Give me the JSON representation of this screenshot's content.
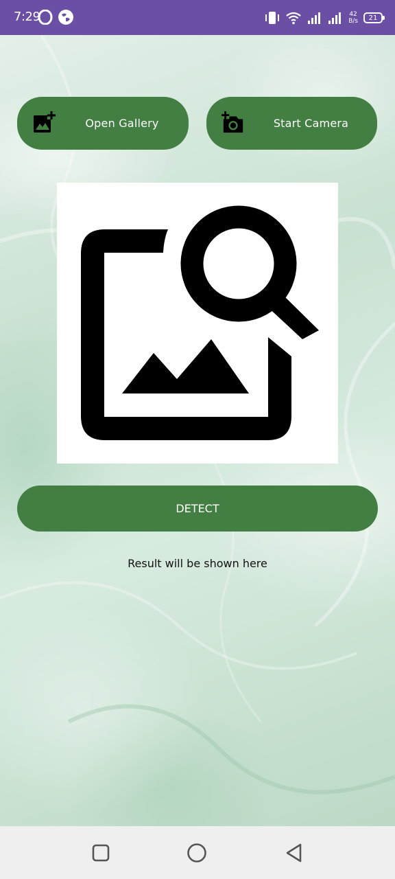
{
  "status_bar": {
    "time": "7:29",
    "net_speed_value": "42",
    "net_speed_unit": "B/s",
    "battery": "21",
    "icons": [
      "opera-icon",
      "vpn-globe-icon",
      "vibrate-icon",
      "wifi-icon",
      "signal-icon",
      "signal-icon",
      "battery-icon"
    ]
  },
  "buttons": {
    "gallery_label": "Open Gallery",
    "camera_label": "Start Camera",
    "detect_label": "DETECT"
  },
  "preview": {
    "icon": "image-search-icon"
  },
  "result": {
    "text": "Result will be shown here"
  },
  "nav_bar": {
    "icons": [
      "recents-icon",
      "home-icon",
      "back-icon"
    ]
  },
  "colors": {
    "status_bar": "#6a4fa5",
    "button": "#437f42",
    "button_text": "#ffffff",
    "nav_bar": "#efefef",
    "background": "#d3e7dc"
  }
}
